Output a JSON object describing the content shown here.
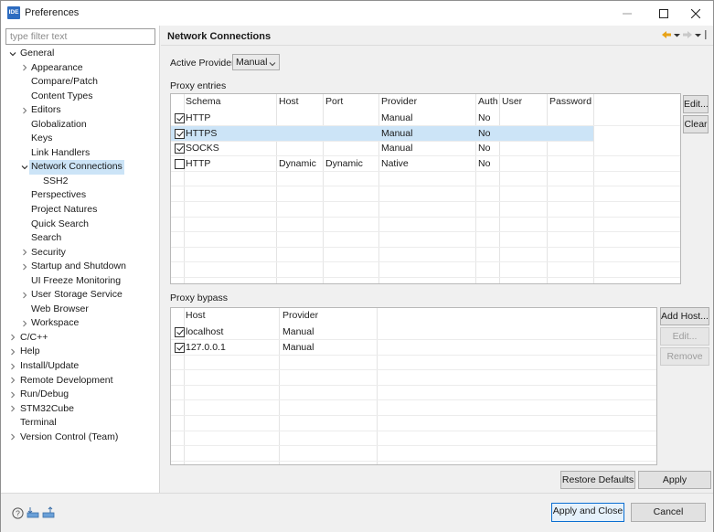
{
  "window": {
    "title": "Preferences",
    "icon_text": "IDE"
  },
  "filter": {
    "placeholder": "type filter text",
    "value": ""
  },
  "tree": [
    {
      "label": "General",
      "level": 0,
      "expand": "open"
    },
    {
      "label": "Appearance",
      "level": 1,
      "expand": "closed"
    },
    {
      "label": "Compare/Patch",
      "level": 1,
      "expand": "none"
    },
    {
      "label": "Content Types",
      "level": 1,
      "expand": "none"
    },
    {
      "label": "Editors",
      "level": 1,
      "expand": "closed"
    },
    {
      "label": "Globalization",
      "level": 1,
      "expand": "none"
    },
    {
      "label": "Keys",
      "level": 1,
      "expand": "none"
    },
    {
      "label": "Link Handlers",
      "level": 1,
      "expand": "none"
    },
    {
      "label": "Network Connections",
      "level": 1,
      "expand": "open",
      "selected": true
    },
    {
      "label": "SSH2",
      "level": 2,
      "expand": "none"
    },
    {
      "label": "Perspectives",
      "level": 1,
      "expand": "none"
    },
    {
      "label": "Project Natures",
      "level": 1,
      "expand": "none"
    },
    {
      "label": "Quick Search",
      "level": 1,
      "expand": "none"
    },
    {
      "label": "Search",
      "level": 1,
      "expand": "none"
    },
    {
      "label": "Security",
      "level": 1,
      "expand": "closed"
    },
    {
      "label": "Startup and Shutdown",
      "level": 1,
      "expand": "closed"
    },
    {
      "label": "UI Freeze Monitoring",
      "level": 1,
      "expand": "none"
    },
    {
      "label": "User Storage Service",
      "level": 1,
      "expand": "closed"
    },
    {
      "label": "Web Browser",
      "level": 1,
      "expand": "none"
    },
    {
      "label": "Workspace",
      "level": 1,
      "expand": "closed"
    },
    {
      "label": "C/C++",
      "level": 0,
      "expand": "closed"
    },
    {
      "label": "Help",
      "level": 0,
      "expand": "closed"
    },
    {
      "label": "Install/Update",
      "level": 0,
      "expand": "closed"
    },
    {
      "label": "Remote Development",
      "level": 0,
      "expand": "closed"
    },
    {
      "label": "Run/Debug",
      "level": 0,
      "expand": "closed"
    },
    {
      "label": "STM32Cube",
      "level": 0,
      "expand": "closed"
    },
    {
      "label": "Terminal",
      "level": 0,
      "expand": "none"
    },
    {
      "label": "Version Control (Team)",
      "level": 0,
      "expand": "closed"
    }
  ],
  "page": {
    "title": "Network Connections",
    "active_provider_label": "Active Provider:",
    "active_provider_value": "Manual"
  },
  "proxy_entries": {
    "label": "Proxy entries",
    "columns": [
      "Schema",
      "Host",
      "Port",
      "Provider",
      "Auth",
      "User",
      "Password"
    ],
    "rows": [
      {
        "checked": true,
        "schema": "HTTP",
        "host": "",
        "port": "",
        "provider": "Manual",
        "auth": "No",
        "user": "",
        "password": "",
        "highlighted": false
      },
      {
        "checked": true,
        "schema": "HTTPS",
        "host": "",
        "port": "",
        "provider": "Manual",
        "auth": "No",
        "user": "",
        "password": "",
        "highlighted": true
      },
      {
        "checked": true,
        "schema": "SOCKS",
        "host": "",
        "port": "",
        "provider": "Manual",
        "auth": "No",
        "user": "",
        "password": "",
        "highlighted": false
      },
      {
        "checked": false,
        "schema": "HTTP",
        "host": "Dynamic",
        "port": "Dynamic",
        "provider": "Native",
        "auth": "No",
        "user": "",
        "password": "",
        "highlighted": false
      }
    ],
    "buttons": {
      "edit": "Edit...",
      "clear": "Clear"
    }
  },
  "proxy_bypass": {
    "label": "Proxy bypass",
    "columns": [
      "Host",
      "Provider"
    ],
    "rows": [
      {
        "checked": true,
        "host": "localhost",
        "provider": "Manual"
      },
      {
        "checked": true,
        "host": "127.0.0.1",
        "provider": "Manual"
      }
    ],
    "buttons": {
      "add_host": "Add Host...",
      "edit": "Edit...",
      "remove": "Remove"
    }
  },
  "actions": {
    "restore_defaults": "Restore Defaults",
    "apply": "Apply",
    "apply_and_close": "Apply and Close",
    "cancel": "Cancel"
  },
  "colors": {
    "selection": "#cce4f7",
    "primary_border": "#0a6ed1",
    "accent_arrow": "#e8a317"
  },
  "icons": [
    "help-icon",
    "import-icon",
    "export-icon",
    "back-icon",
    "forward-icon",
    "view-menu-icon",
    "minimize-icon",
    "maximize-icon",
    "close-icon"
  ]
}
